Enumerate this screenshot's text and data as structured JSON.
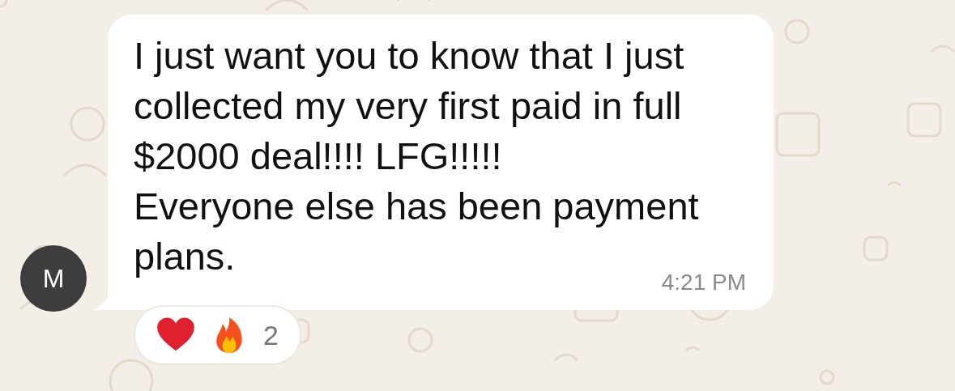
{
  "message": {
    "sender_initial": "M",
    "text": "I just want you to know that I just collected my very first paid in full $2000 deal!!!! LFG!!!!!\nEveryone else has been payment plans.",
    "time": "4:21 PM"
  },
  "reactions": {
    "count": "2"
  }
}
